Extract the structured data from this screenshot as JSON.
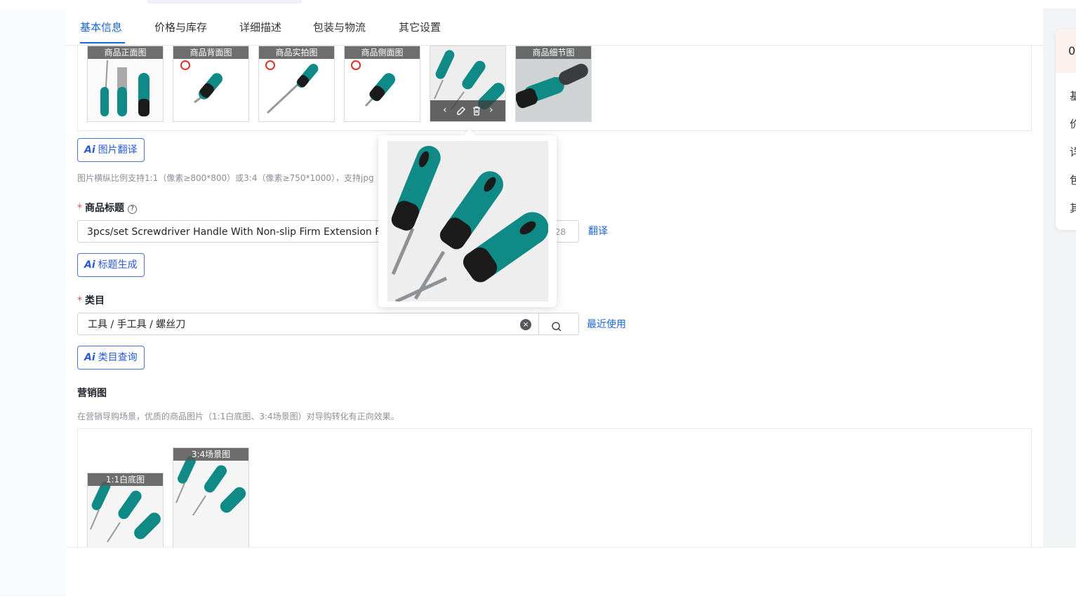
{
  "tabs": [
    "基本信息",
    "价格与库存",
    "详细描述",
    "包装与物流",
    "其它设置"
  ],
  "images": {
    "captions": [
      "商品正面图",
      "商品背面图",
      "商品实拍图",
      "商品侧面图",
      "",
      "商品细节图"
    ],
    "controls": {
      "prev": "‹",
      "next": "›"
    }
  },
  "ai_translate_image": "图片翻译",
  "image_hint": "图片横纵比例支持1:1（像素≥800*800）或3:4（像素≥750*1000），支持jpg",
  "title_field": {
    "required": "*",
    "label": "商品标题",
    "value": "3pcs/set Screwdriver Handle With Non-slip Firm Extension Fo",
    "counter": "28",
    "translate": "翻译",
    "ai_generate": "标题生成"
  },
  "category_field": {
    "required": "*",
    "label": "类目",
    "value": "工具 / 手工具 / 螺丝刀",
    "recent": "最近使用",
    "ai_query": "类目查询"
  },
  "marketing": {
    "label": "营销图",
    "hint": "在营销导购场景，优质的商品图片（1:1白底图、3:4场景图）对导购转化有正向效果。",
    "captions": [
      "1:1白底图",
      "3:4场景图"
    ]
  },
  "ai_mark": "Ai",
  "right_panel": {
    "score": "0",
    "items": [
      "基",
      "价",
      "详",
      "包",
      "其"
    ]
  },
  "colors": {
    "accent": "#1a66d6",
    "teal": "#0f8a86",
    "required": "#e34d59"
  }
}
